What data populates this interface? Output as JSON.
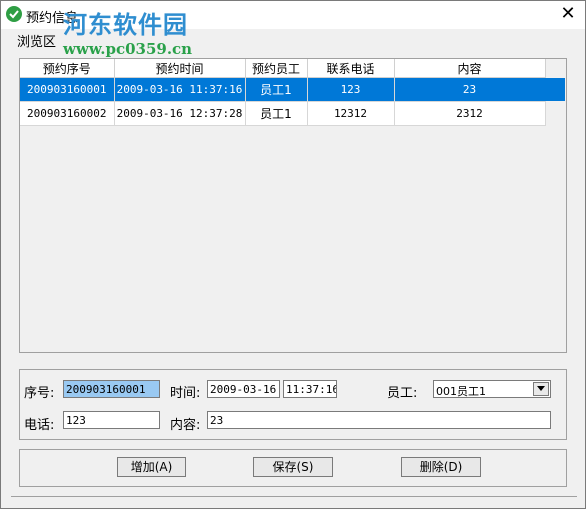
{
  "window": {
    "title": "预约信息",
    "close_glyph": "✕",
    "watermark": "河东软件园",
    "watermark_url": "www.pc0359.cn",
    "icon": "check-circle-icon"
  },
  "browse_group": {
    "label": "浏览区"
  },
  "grid": {
    "headers": [
      "预约序号",
      "预约时间",
      "预约员工",
      "联系电话",
      "内容"
    ],
    "rows": [
      {
        "id": "200903160001",
        "time": "2009-03-16 11:37:16",
        "staff": "员工1",
        "phone": "123",
        "content": "23"
      },
      {
        "id": "200903160002",
        "time": "2009-03-16 12:37:28",
        "staff": "员工1",
        "phone": "12312",
        "content": "2312"
      }
    ],
    "selected_row": 0,
    "selection_color": "#0078d7"
  },
  "form": {
    "serial_label": "序号:",
    "serial_value": "200903160001",
    "time_label": "时间:",
    "date_value": "2009-03-16",
    "time_value": "11:37:16",
    "staff_label": "员工:",
    "staff_value": "001员工1",
    "phone_label": "电话:",
    "phone_value": "123",
    "content_label": "内容:",
    "content_value": "23"
  },
  "buttons": {
    "add": "增加(A)",
    "save": "保存(S)",
    "delete": "删除(D)"
  }
}
